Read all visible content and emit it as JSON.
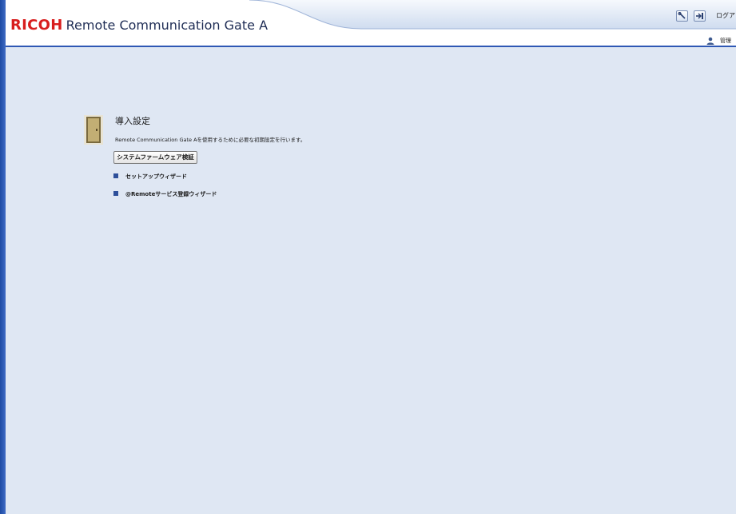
{
  "header": {
    "brand": "RICOH",
    "product": "Remote Communication Gate A",
    "logout_label": "ログアウ",
    "user_label": "管理"
  },
  "icons": {
    "settings_tool": "wrench-icon",
    "logout": "logout-arrow-icon",
    "user": "user-icon",
    "section": "door-icon",
    "bullet": "square-bullet-icon"
  },
  "setup": {
    "title": "導入設定",
    "description": "Remote Communication Gate Aを使用するために必要な初期設定を行います。",
    "verify_button": "システムファームウェア検証",
    "links": [
      "セットアップウィザード",
      "@Remoteサービス登録ウィザード"
    ]
  },
  "colors": {
    "accent": "#2f58b4",
    "brand_red": "#d81e1e",
    "content_bg": "#dfe7f3",
    "bullet": "#2d4f9a"
  }
}
